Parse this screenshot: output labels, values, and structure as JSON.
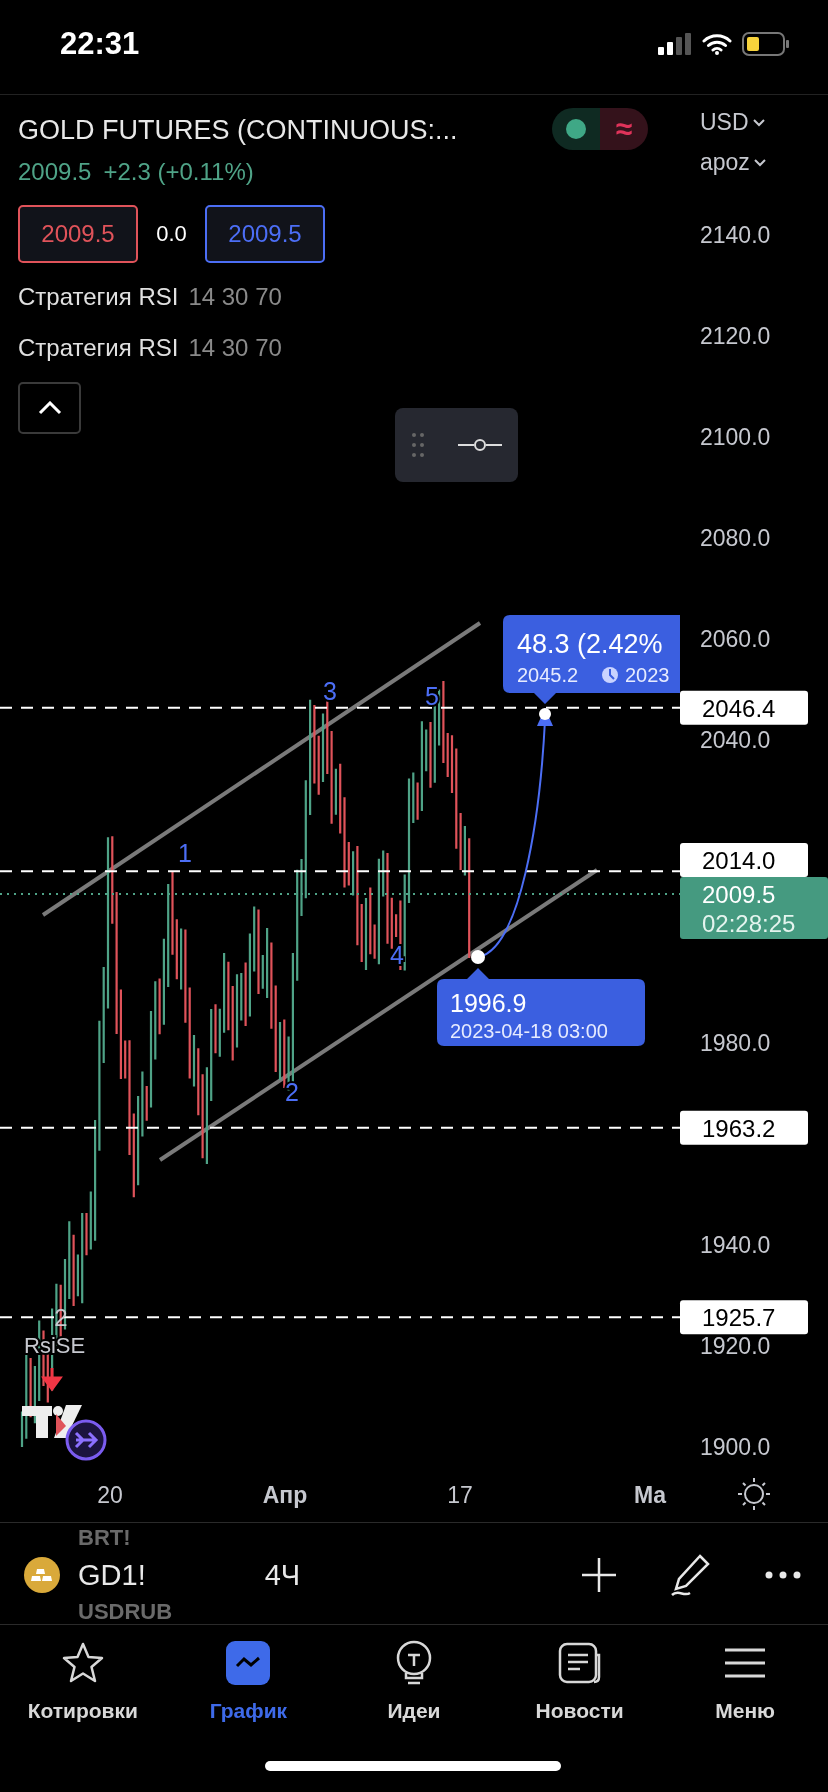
{
  "status_bar": {
    "time": "22:31"
  },
  "header": {
    "title": "GOLD FUTURES (CONTINUOUS:...",
    "price": "2009.5",
    "change": "+2.3 (+0.11%)",
    "market_toggle": {
      "symbol": "≈"
    },
    "sell": "2009.5",
    "spread": "0.0",
    "buy": "2009.5",
    "indicators": [
      {
        "name": "Стратегия RSI",
        "params": "14 30 70"
      },
      {
        "name": "Стратегия RSI",
        "params": "14 30 70"
      }
    ]
  },
  "chart": {
    "currency": "USD",
    "scale": "apoz",
    "y_axis_labels": [
      "2140.0",
      "2120.0",
      "2100.0",
      "2080.0",
      "2060.0",
      "2040.0",
      "1980.0",
      "1940.0",
      "1920.0",
      "1900.0"
    ],
    "price_lines": [
      {
        "kind": "level",
        "label": "2046.4"
      },
      {
        "kind": "level",
        "label": "2014.0"
      },
      {
        "kind": "last",
        "label": "2009.5",
        "countdown": "02:28:25"
      },
      {
        "kind": "level",
        "label": "1963.2"
      },
      {
        "kind": "level",
        "label": "1925.7"
      }
    ],
    "x_axis_labels": [
      {
        "kind": "day",
        "label": "20"
      },
      {
        "kind": "month",
        "label": "Апр"
      },
      {
        "kind": "day",
        "label": "17"
      },
      {
        "kind": "month",
        "label": "Ма"
      }
    ],
    "wave_labels": [
      "1",
      "2",
      "3",
      "4",
      "5"
    ],
    "extra_wave_label": "2",
    "strategy_label": "RsiSE",
    "projection": {
      "change": "48.3 (2.42%",
      "target": "2045.2",
      "target_time": "2023",
      "start_price": "1996.9",
      "start_time": "2023-04-18 03:00"
    }
  },
  "symbol_bar": {
    "ghost_above": "BRT!",
    "symbol": "GD1!",
    "interval": "4Ч",
    "ghost_below": "USDRUB"
  },
  "tabs": [
    {
      "label": "Котировки",
      "selected": false
    },
    {
      "label": "График",
      "selected": true
    },
    {
      "label": "Идеи",
      "selected": false
    },
    {
      "label": "Новости",
      "selected": false
    },
    {
      "label": "Меню",
      "selected": false
    }
  ]
}
